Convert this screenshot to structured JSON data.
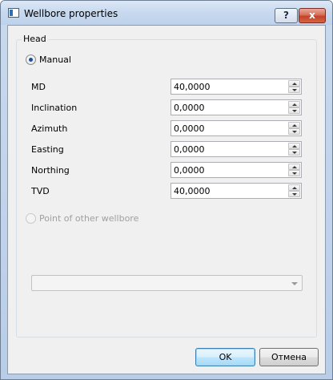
{
  "window": {
    "title": "Wellbore properties",
    "help_label": "?",
    "close_label": "x"
  },
  "head_group": {
    "legend": "Head",
    "manual": {
      "label": "Manual",
      "checked": true
    },
    "fields": [
      {
        "label": "MD",
        "value": "40,0000"
      },
      {
        "label": "Inclination",
        "value": "0,0000"
      },
      {
        "label": "Azimuth",
        "value": "0,0000"
      },
      {
        "label": "Easting",
        "value": "0,0000"
      },
      {
        "label": "Northing",
        "value": "0,0000"
      },
      {
        "label": "TVD",
        "value": "40,0000"
      }
    ],
    "point_of_other_wellbore": {
      "label": "Point of other wellbore",
      "checked": false,
      "enabled": false
    },
    "wellbore_select": {
      "value": "",
      "enabled": false
    }
  },
  "buttons": {
    "ok_label": "OK",
    "cancel_label": "Отмена"
  },
  "colors": {
    "title_bar": "#c7d9ef",
    "close_button": "#c1432a",
    "default_button_border": "#3c7fb1",
    "radio_dot": "#1b4f91"
  }
}
